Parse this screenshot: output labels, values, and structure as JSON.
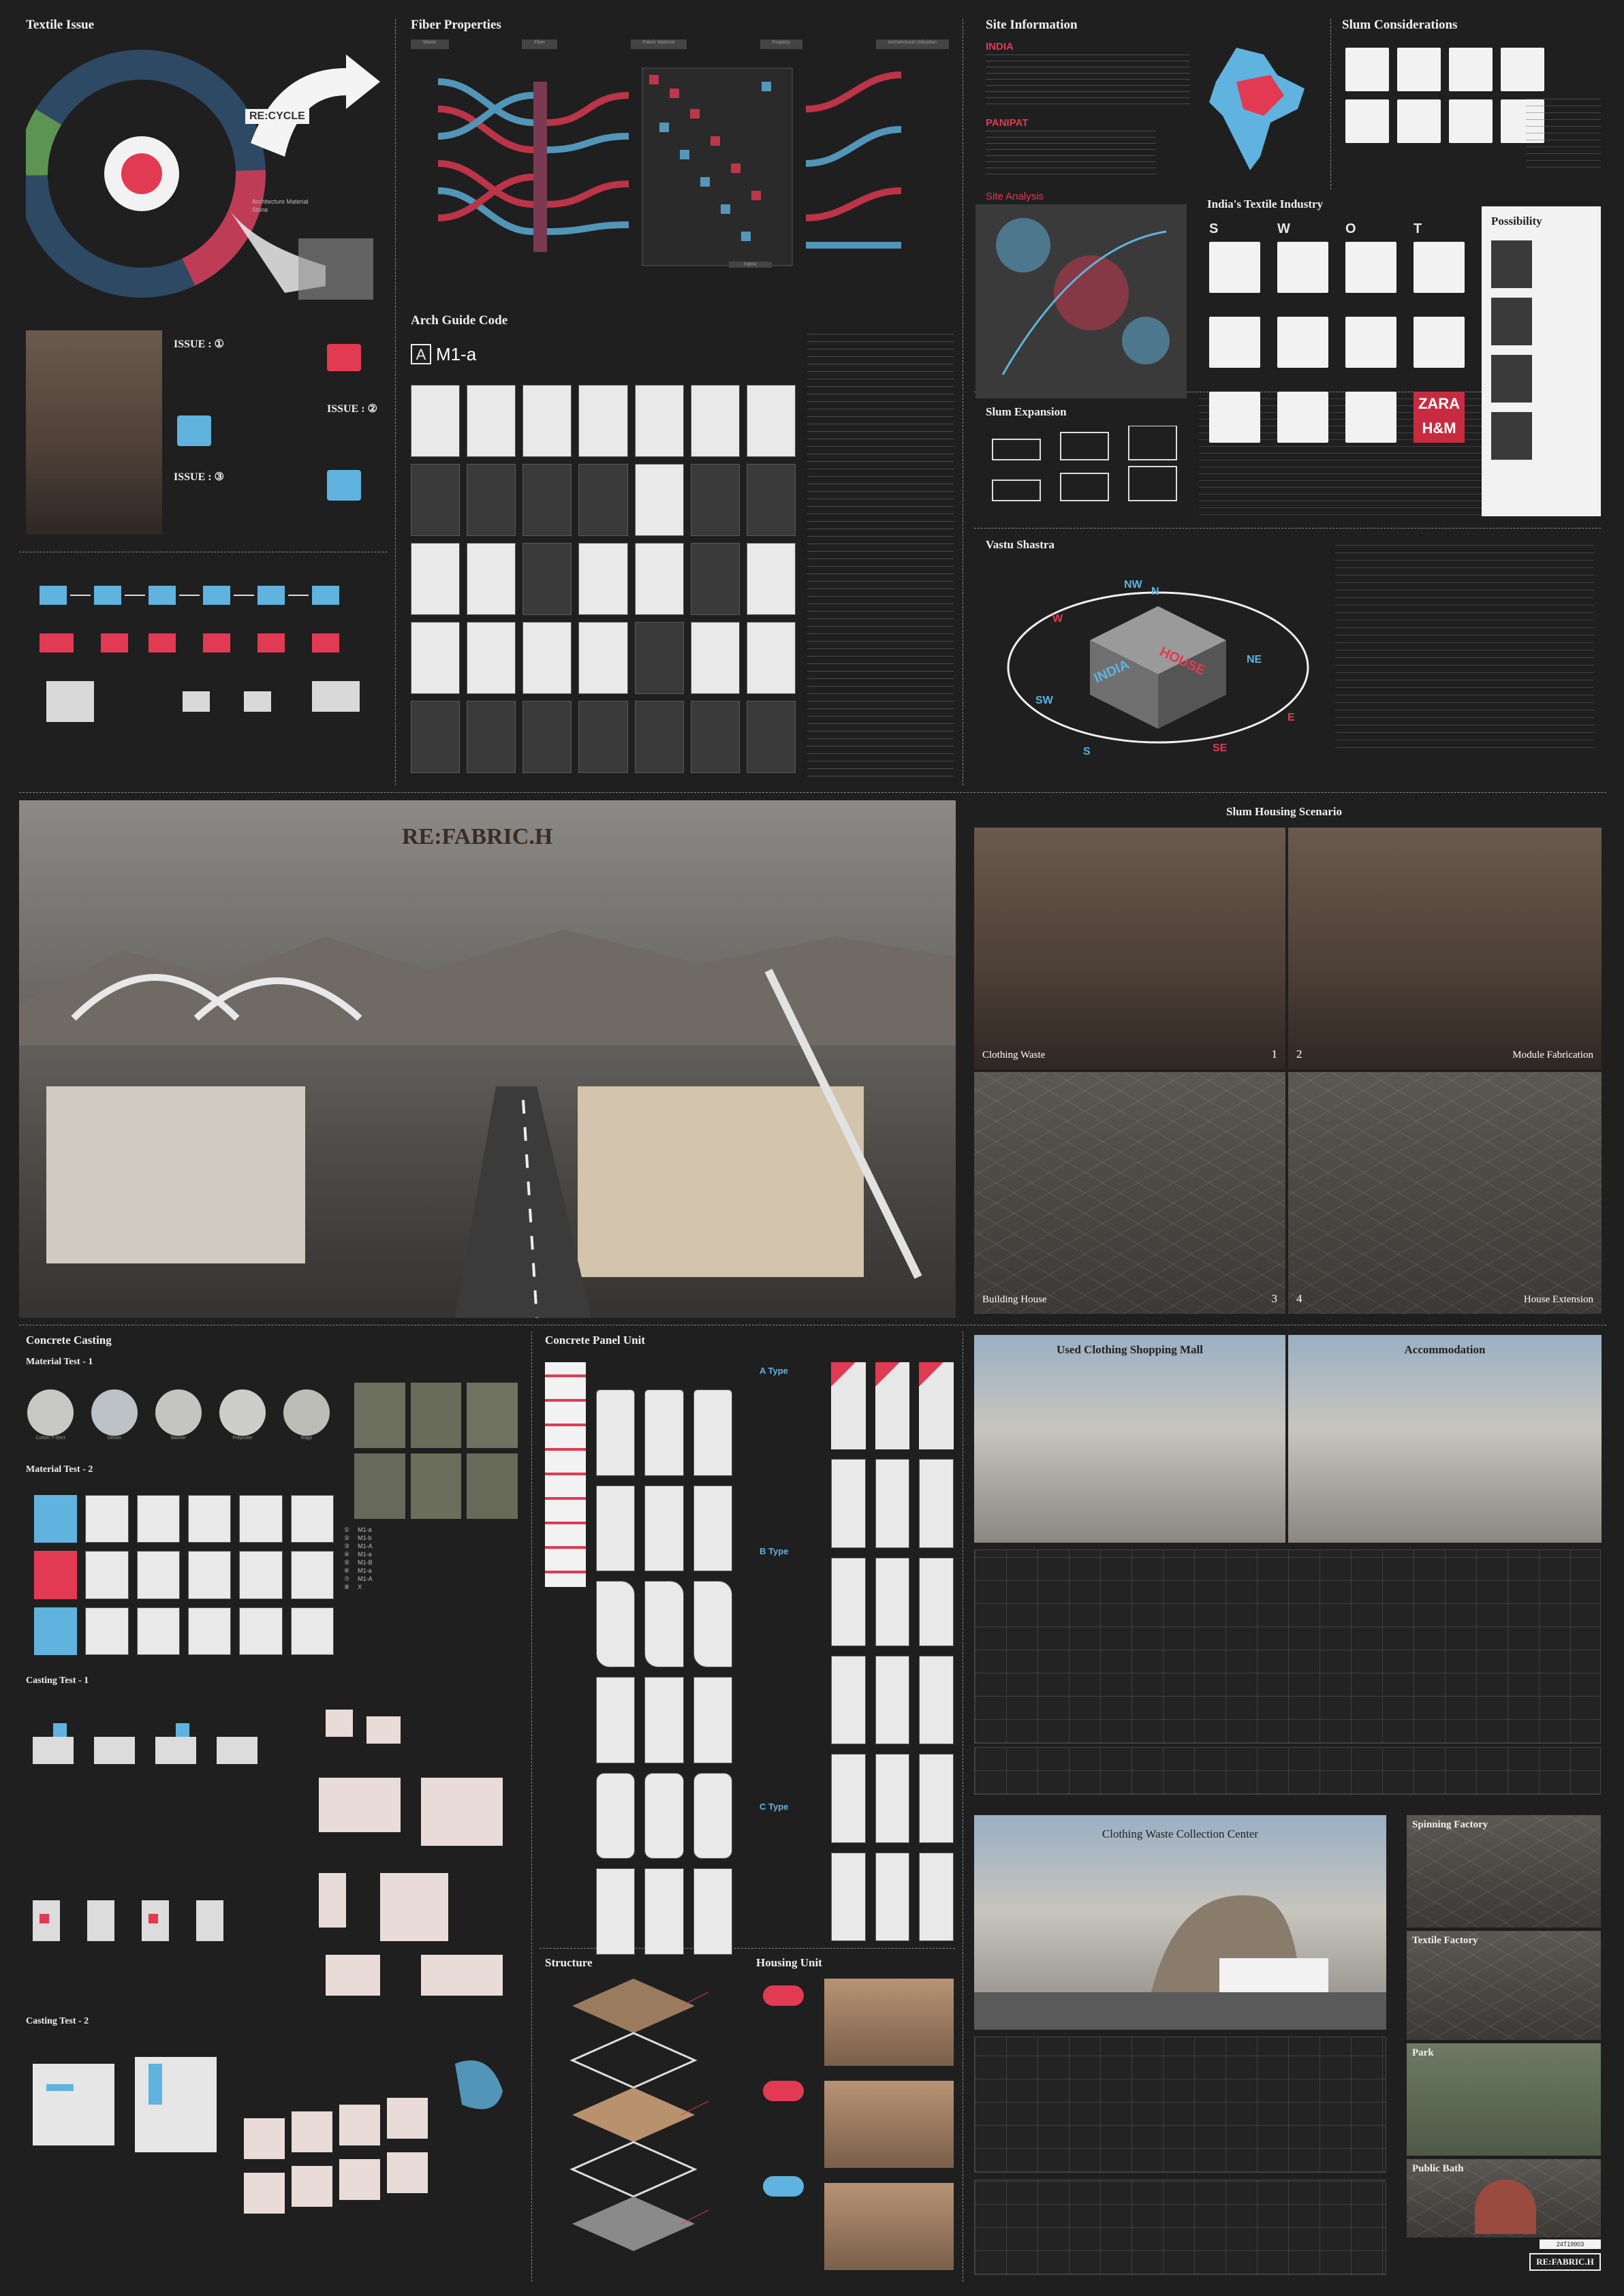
{
  "sections": {
    "textile_issue": {
      "title": "Textile Issue",
      "issue1": "ISSUE : ①",
      "issue2": "ISSUE : ②",
      "issue3": "ISSUE : ③",
      "recycle": "RE:CYCLE",
      "architecture_material": "Architecture Material Stone"
    },
    "fiber_properties": {
      "title": "Fiber Properties",
      "columns": [
        "Waste",
        "Fiber",
        "Fabric Material",
        "Property",
        "Architectural Utilization"
      ],
      "fabric_label": "Fabric"
    },
    "arch_guide_code": {
      "title": "Arch Guide Code",
      "code": "M1-a"
    },
    "site_information": {
      "title": "Site Information",
      "india": "INDIA",
      "panipat": "PANIPAT",
      "site_analysis": "Site Analysis",
      "slum_expansion": "Slum Expansion",
      "vastu_shastra": "Vastu Shastra",
      "vastu_center": [
        "INDIA",
        "HOUSE"
      ],
      "vastu_dirs": [
        "N",
        "NE",
        "E",
        "SE",
        "S",
        "SW",
        "W",
        "NW"
      ]
    },
    "slum_considerations": {
      "title": "Slum Considerations"
    },
    "india_textile_industry": {
      "title": "India's Textile Industry",
      "swot": [
        "S",
        "W",
        "O",
        "T"
      ],
      "brands": [
        "ZARA",
        "H&M"
      ]
    },
    "possibility": {
      "title": "Possibility"
    },
    "hero": {
      "title": "RE:FABRIC.H"
    },
    "slum_housing_scenario": {
      "title": "Slum Housing Scenario",
      "panels": [
        {
          "label": "Clothing Waste",
          "num": "1"
        },
        {
          "label": "Module Fabrication",
          "num": "2"
        },
        {
          "label": "Building House",
          "num": "3"
        },
        {
          "label": "House Extension",
          "num": "4"
        }
      ]
    },
    "concrete_casting": {
      "title": "Concrete Casting",
      "mt1": "Material Test - 1",
      "mt2": "Material Test - 2",
      "ct1": "Casting Test - 1",
      "ct2": "Casting Test - 2",
      "samples": [
        "Cotton T-Shirt",
        "Denim",
        "Banner",
        "Polyester",
        "Rags"
      ],
      "codes": [
        "M1-a",
        "M1-b",
        "M1-A",
        "M1-a",
        "M1-B",
        "M1-a",
        "M1-A",
        "X"
      ]
    },
    "concrete_panel_unit": {
      "title": "Concrete Panel Unit",
      "types": [
        "A Type",
        "B Type",
        "C Type"
      ]
    },
    "structure": {
      "title": "Structure"
    },
    "housing_unit": {
      "title": "Housing Unit"
    },
    "used_clothing_mall": {
      "title": "Used Clothing Shopping Mall"
    },
    "accommodation": {
      "title": "Accommodation"
    },
    "collection_center": {
      "title": "Clothing Waste Collection Center"
    },
    "facilities": [
      "Spinning Factory",
      "Textile Factory",
      "Park",
      "Public Bath"
    ],
    "footer": {
      "code": "24T19903",
      "brand": "RE:FABRIC.H"
    }
  },
  "colors": {
    "bg": "#1f1f1f",
    "red": "#e23a52",
    "blue": "#5fb3de",
    "text": "#f0f0f0"
  }
}
